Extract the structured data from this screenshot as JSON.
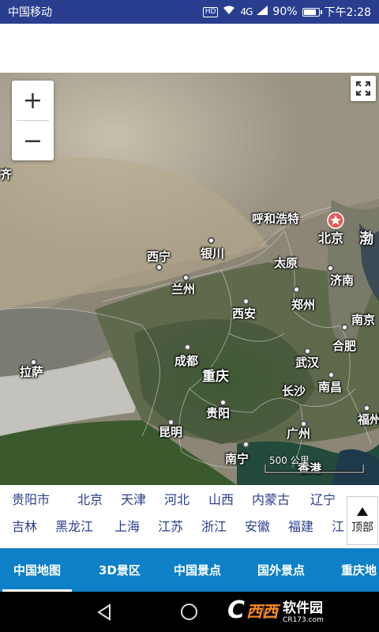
{
  "status_bar": {
    "carrier": "中国移动",
    "hd": "HD",
    "network": "4G",
    "battery": "90%",
    "battery_level": 0.9,
    "time": "下午2:28"
  },
  "map": {
    "zoom_in": "+",
    "zoom_out": "−",
    "scale": "500 公里",
    "cities": [
      "齐",
      "呼和浩特",
      "北京",
      "渤",
      "西宁",
      "银川",
      "太原",
      "济南",
      "兰州",
      "郑州",
      "西安",
      "南京",
      "合肥",
      "拉萨",
      "成都",
      "武汉",
      "重庆",
      "南昌",
      "长沙",
      "贵阳",
      "福州",
      "昆明",
      "广州",
      "南宁",
      "香港"
    ]
  },
  "provinces": {
    "row1": [
      "贵阳市",
      "北京",
      "天津",
      "河北",
      "山西",
      "内蒙古",
      "辽宁"
    ],
    "row2": [
      "吉林",
      "黑龙江",
      "上海",
      "江苏",
      "浙江",
      "安徽",
      "福建",
      "江"
    ],
    "top_button": "顶部"
  },
  "tabs": [
    "中国地图",
    "3D景区",
    "中国景点",
    "国外景点",
    "重庆地"
  ],
  "watermark": {
    "logo": "C",
    "name": "西西",
    "title": "软件园",
    "url": "CR173.com"
  },
  "colors": {
    "status_bar": "#2a3e8f",
    "tab_bar": "#0e80c8",
    "province_link": "#2a3e8f"
  }
}
